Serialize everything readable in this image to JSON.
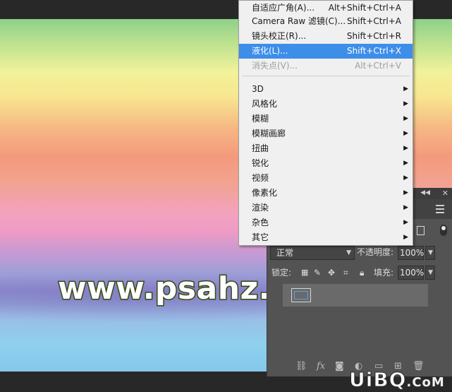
{
  "watermark": "www.psahz.com",
  "footer_logo": {
    "main": "UiBQ",
    "suffix": ".CoM"
  },
  "filter_menu": {
    "top_items": [
      {
        "label": "自适应广角(A)...",
        "shortcut": "Alt+Shift+Ctrl+A",
        "state": "normal"
      },
      {
        "label": "Camera Raw 滤镜(C)...",
        "shortcut": "Shift+Ctrl+A",
        "state": "normal"
      },
      {
        "label": "镜头校正(R)...",
        "shortcut": "Shift+Ctrl+R",
        "state": "normal"
      },
      {
        "label": "液化(L)...",
        "shortcut": "Shift+Ctrl+X",
        "state": "highlighted"
      },
      {
        "label": "消失点(V)...",
        "shortcut": "Alt+Ctrl+V",
        "state": "disabled"
      }
    ],
    "submenus": [
      "3D",
      "风格化",
      "模糊",
      "模糊画廊",
      "扭曲",
      "锐化",
      "视频",
      "像素化",
      "渲染",
      "杂色",
      "其它"
    ],
    "submenu_arrow": "▶"
  },
  "layers_panel": {
    "blend_mode": "正常",
    "opacity_label": "不透明度:",
    "opacity_value": "100%",
    "lock_label": "锁定:",
    "fill_label": "填充:",
    "fill_value": "100%",
    "footer_icons": [
      "link-icon",
      "fx-icon",
      "mask-icon",
      "adjustment-icon",
      "group-icon",
      "new-layer-icon",
      "trash-icon"
    ],
    "fx_text": "fx"
  },
  "colors": {
    "menu_highlight": "#3d8ee9",
    "panel_bg": "#535353",
    "app_bg": "#282828"
  }
}
